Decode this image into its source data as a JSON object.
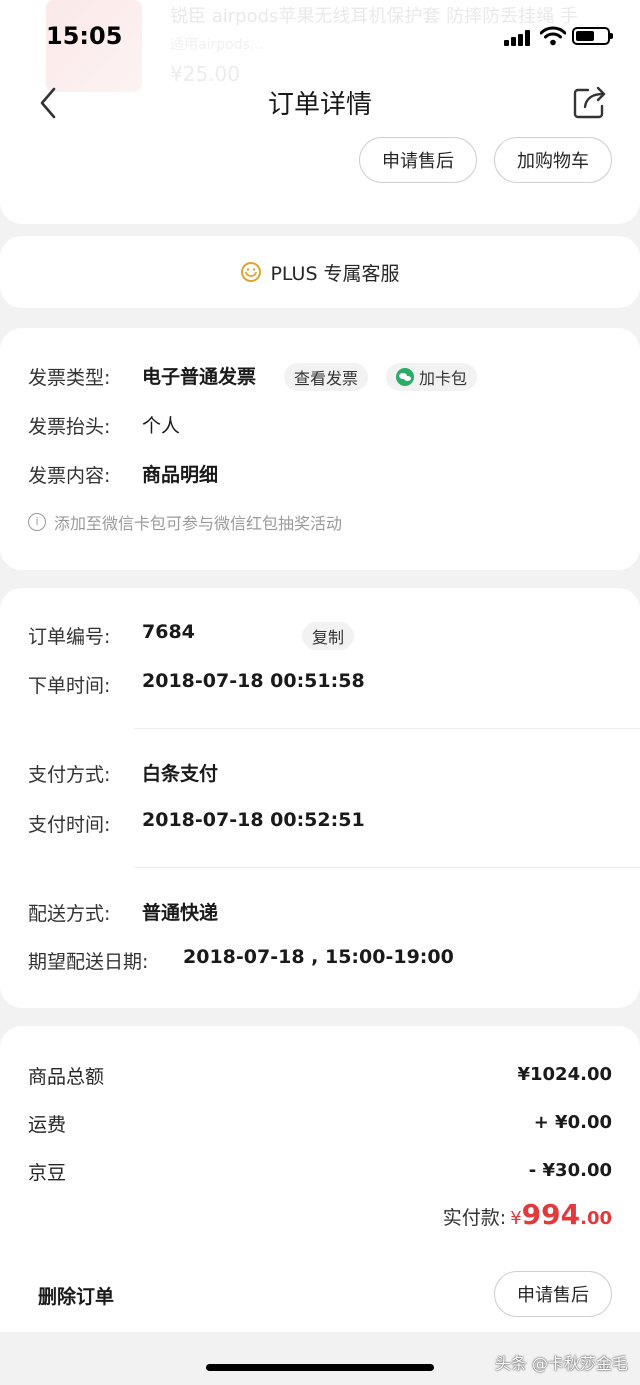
{
  "status_bar": {
    "time": "15:05"
  },
  "ghost_product": {
    "title": "锐臣 airpods苹果无线耳机保护套 防摔防丢挂绳 手",
    "sub": "适用airpods...",
    "price": "¥25.00"
  },
  "header": {
    "title": "订单详情"
  },
  "top_actions": {
    "after_sale": "申请售后",
    "add_cart": "加购物车"
  },
  "service": {
    "label": "PLUS 专属客服"
  },
  "invoice": {
    "type_label": "发票类型:",
    "type_value": "电子普通发票",
    "view_chip": "查看发票",
    "wallet_chip": "加卡包",
    "title_label": "发票抬头:",
    "title_value": "个人",
    "content_label": "发票内容:",
    "content_value": "商品明细",
    "hint": "添加至微信卡包可参与微信红包抽奖活动"
  },
  "order": {
    "no_label": "订单编号:",
    "no_value": "7684",
    "copy": "复制",
    "time_label": "下单时间:",
    "time_value": "2018-07-18 00:51:58",
    "pay_label": "支付方式:",
    "pay_value": "白条支付",
    "pay_time_label": "支付时间:",
    "pay_time_value": "2018-07-18 00:52:51",
    "ship_label": "配送方式:",
    "ship_value": "普通快递",
    "date_label": "期望配送日期:",
    "date_value": "2018-07-18 , 15:00-19:00"
  },
  "totals": {
    "goods_label": "商品总额",
    "goods_value": "¥1024.00",
    "freight_label": "运费",
    "freight_value": "+ ¥0.00",
    "bean_label": "京豆",
    "bean_value": "- ¥30.00",
    "paid_label": "实付款:",
    "paid_currency": "¥",
    "paid_int": "994",
    "paid_dec": ".00"
  },
  "bottom": {
    "delete": "删除订单",
    "after_sale": "申请售后"
  },
  "watermark": "头条 @卡秋莎金毛",
  "colors": {
    "accent_red": "#e4393c",
    "wechat_green": "#2aae67"
  }
}
